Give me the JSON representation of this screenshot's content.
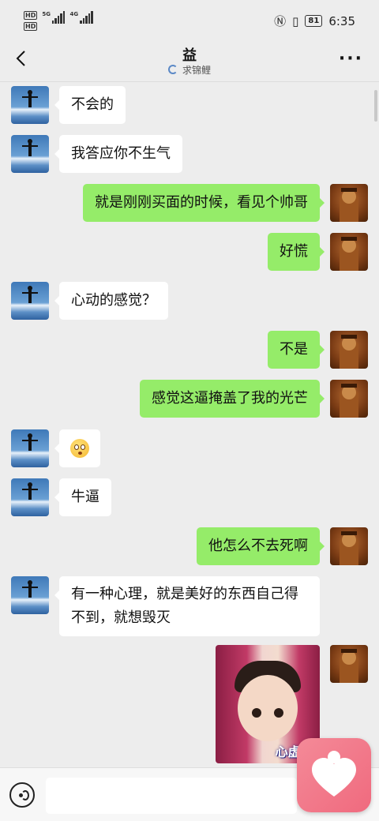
{
  "status_bar": {
    "hd1": "HD",
    "hd2": "HD",
    "net1": "5G",
    "net2": "4G",
    "battery": "81",
    "time": "6:35"
  },
  "header": {
    "title": "益",
    "subtitle": "求锦鲤"
  },
  "messages": [
    {
      "side": "left",
      "text": "不会的"
    },
    {
      "side": "left",
      "text": "我答应你不生气"
    },
    {
      "side": "right",
      "text": "就是刚刚买面的时候，看见个帅哥"
    },
    {
      "side": "right",
      "text": "好慌"
    },
    {
      "side": "left",
      "text": "心动的感觉？"
    },
    {
      "side": "right",
      "text": "不是"
    },
    {
      "side": "right",
      "text": "感觉这逼掩盖了我的光芒"
    },
    {
      "side": "left",
      "emoji": "flushed-face-emoji"
    },
    {
      "side": "left",
      "text": "牛逼"
    },
    {
      "side": "right",
      "text": "他怎么不去死啊"
    },
    {
      "side": "left",
      "text": "有一种心理，就是美好的东西自己得不到，就想毁灭"
    },
    {
      "side": "right",
      "sticker_caption": "心虚..."
    }
  ],
  "input": {
    "value": "",
    "placeholder": ""
  },
  "colors": {
    "background": "#ededed",
    "outgoing_bubble": "#95ec69",
    "incoming_bubble": "#ffffff",
    "favorite_button": "#f06a7e"
  }
}
